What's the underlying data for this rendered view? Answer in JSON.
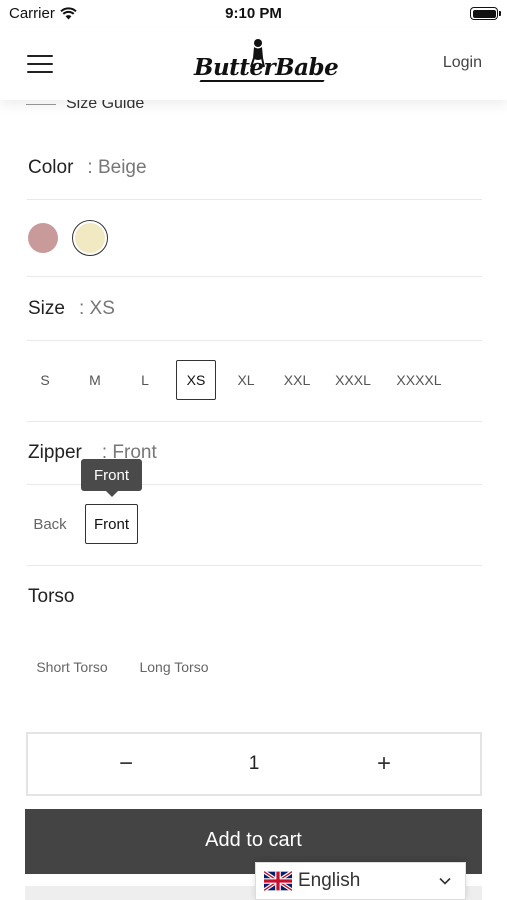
{
  "status_bar": {
    "carrier": "Carrier",
    "time": "9:10 PM"
  },
  "header": {
    "brand": "ButterBabe",
    "login_label": "Login"
  },
  "size_guide": {
    "label": "Size Guide"
  },
  "color": {
    "label": "Color",
    "selected": ": Beige",
    "swatches": [
      {
        "name": "dusty-rose",
        "hex": "#c89a9a"
      },
      {
        "name": "beige",
        "hex": "#f0e9c2"
      }
    ]
  },
  "size": {
    "label": "Size",
    "selected": ": XS",
    "options": [
      "S",
      "M",
      "L",
      "XS",
      "XL",
      "XXL",
      "XXXL",
      "XXXXL"
    ]
  },
  "zipper": {
    "label": "Zipper",
    "selected": ": Front",
    "tooltip": "Front",
    "options": [
      "Back",
      "Front"
    ]
  },
  "torso": {
    "label": "Torso",
    "options": [
      "Short Torso",
      "Long Torso"
    ]
  },
  "quantity": {
    "minus": "−",
    "value": "1",
    "plus": "+"
  },
  "cart": {
    "add_label": "Add to cart"
  },
  "language": {
    "label": "English"
  }
}
